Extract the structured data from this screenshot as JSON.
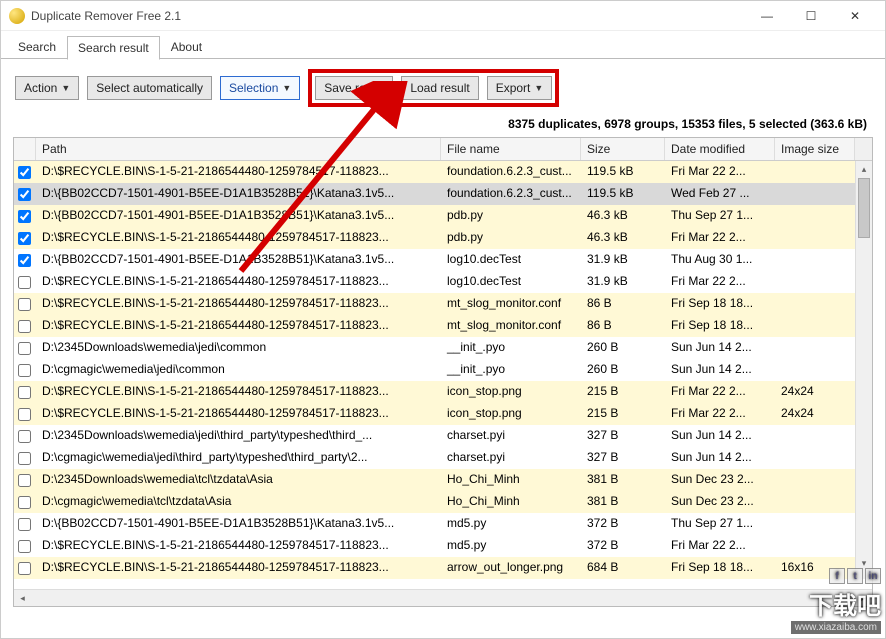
{
  "window": {
    "title": "Duplicate Remover Free 2.1",
    "min": "—",
    "max": "☐",
    "close": "✕"
  },
  "tabs": {
    "search": "Search",
    "search_result": "Search result",
    "about": "About"
  },
  "toolbar": {
    "action": "Action",
    "select_auto": "Select automatically",
    "selection": "Selection",
    "save_result": "Save result",
    "load_result": "Load result",
    "export": "Export"
  },
  "status": "8375 duplicates, 6978 groups, 15353 files, 5 selected (363.6 kB)",
  "columns": {
    "path": "Path",
    "file": "File name",
    "size": "Size",
    "date": "Date modified",
    "img": "Image size"
  },
  "rows": [
    {
      "chk": true,
      "bg": "y",
      "path": "D:\\$RECYCLE.BIN\\S-1-5-21-2186544480-1259784517-118823...",
      "file": "foundation.6.2.3_cust...",
      "size": "119.5 kB",
      "date": "Fri Mar 22 2...",
      "img": ""
    },
    {
      "chk": true,
      "bg": "sel",
      "path": "D:\\{BB02CCD7-1501-4901-B5EE-D1A1B3528B51}\\Katana3.1v5...",
      "file": "foundation.6.2.3_cust...",
      "size": "119.5 kB",
      "date": "Wed Feb 27 ...",
      "img": ""
    },
    {
      "chk": true,
      "bg": "y",
      "path": "D:\\{BB02CCD7-1501-4901-B5EE-D1A1B3528B51}\\Katana3.1v5...",
      "file": "pdb.py",
      "size": "46.3 kB",
      "date": "Thu Sep 27 1...",
      "img": ""
    },
    {
      "chk": true,
      "bg": "y",
      "path": "D:\\$RECYCLE.BIN\\S-1-5-21-2186544480-1259784517-118823...",
      "file": "pdb.py",
      "size": "46.3 kB",
      "date": "Fri Mar 22 2...",
      "img": ""
    },
    {
      "chk": true,
      "bg": "w",
      "path": "D:\\{BB02CCD7-1501-4901-B5EE-D1A1B3528B51}\\Katana3.1v5...",
      "file": "log10.decTest",
      "size": "31.9 kB",
      "date": "Thu Aug 30 1...",
      "img": ""
    },
    {
      "chk": false,
      "bg": "w",
      "path": "D:\\$RECYCLE.BIN\\S-1-5-21-2186544480-1259784517-118823...",
      "file": "log10.decTest",
      "size": "31.9 kB",
      "date": "Fri Mar 22 2...",
      "img": ""
    },
    {
      "chk": false,
      "bg": "y",
      "path": "D:\\$RECYCLE.BIN\\S-1-5-21-2186544480-1259784517-118823...",
      "file": "mt_slog_monitor.conf",
      "size": "86 B",
      "date": "Fri Sep 18 18...",
      "img": ""
    },
    {
      "chk": false,
      "bg": "y",
      "path": "D:\\$RECYCLE.BIN\\S-1-5-21-2186544480-1259784517-118823...",
      "file": "mt_slog_monitor.conf",
      "size": "86 B",
      "date": "Fri Sep 18 18...",
      "img": ""
    },
    {
      "chk": false,
      "bg": "w",
      "path": "D:\\2345Downloads\\wemedia\\jedi\\common",
      "file": "__init_.pyo",
      "size": "260 B",
      "date": "Sun Jun 14 2...",
      "img": ""
    },
    {
      "chk": false,
      "bg": "w",
      "path": "D:\\cgmagic\\wemedia\\jedi\\common",
      "file": "__init_.pyo",
      "size": "260 B",
      "date": "Sun Jun 14 2...",
      "img": ""
    },
    {
      "chk": false,
      "bg": "y",
      "path": "D:\\$RECYCLE.BIN\\S-1-5-21-2186544480-1259784517-118823...",
      "file": "icon_stop.png",
      "size": "215 B",
      "date": "Fri Mar 22 2...",
      "img": "24x24"
    },
    {
      "chk": false,
      "bg": "y",
      "path": "D:\\$RECYCLE.BIN\\S-1-5-21-2186544480-1259784517-118823...",
      "file": "icon_stop.png",
      "size": "215 B",
      "date": "Fri Mar 22 2...",
      "img": "24x24"
    },
    {
      "chk": false,
      "bg": "w",
      "path": "D:\\2345Downloads\\wemedia\\jedi\\third_party\\typeshed\\third_...",
      "file": "charset.pyi",
      "size": "327 B",
      "date": "Sun Jun 14 2...",
      "img": ""
    },
    {
      "chk": false,
      "bg": "w",
      "path": "D:\\cgmagic\\wemedia\\jedi\\third_party\\typeshed\\third_party\\2...",
      "file": "charset.pyi",
      "size": "327 B",
      "date": "Sun Jun 14 2...",
      "img": ""
    },
    {
      "chk": false,
      "bg": "y",
      "path": "D:\\2345Downloads\\wemedia\\tcl\\tzdata\\Asia",
      "file": "Ho_Chi_Minh",
      "size": "381 B",
      "date": "Sun Dec 23 2...",
      "img": ""
    },
    {
      "chk": false,
      "bg": "y",
      "path": "D:\\cgmagic\\wemedia\\tcl\\tzdata\\Asia",
      "file": "Ho_Chi_Minh",
      "size": "381 B",
      "date": "Sun Dec 23 2...",
      "img": ""
    },
    {
      "chk": false,
      "bg": "w",
      "path": "D:\\{BB02CCD7-1501-4901-B5EE-D1A1B3528B51}\\Katana3.1v5...",
      "file": "md5.py",
      "size": "372 B",
      "date": "Thu Sep 27 1...",
      "img": ""
    },
    {
      "chk": false,
      "bg": "w",
      "path": "D:\\$RECYCLE.BIN\\S-1-5-21-2186544480-1259784517-118823...",
      "file": "md5.py",
      "size": "372 B",
      "date": "Fri Mar 22 2...",
      "img": ""
    },
    {
      "chk": false,
      "bg": "y",
      "path": "D:\\$RECYCLE.BIN\\S-1-5-21-2186544480-1259784517-118823...",
      "file": "arrow_out_longer.png",
      "size": "684 B",
      "date": "Fri Sep 18 18...",
      "img": "16x16"
    }
  ],
  "watermark": {
    "main": "下载吧",
    "sub": "www.xiazaiba.com"
  }
}
